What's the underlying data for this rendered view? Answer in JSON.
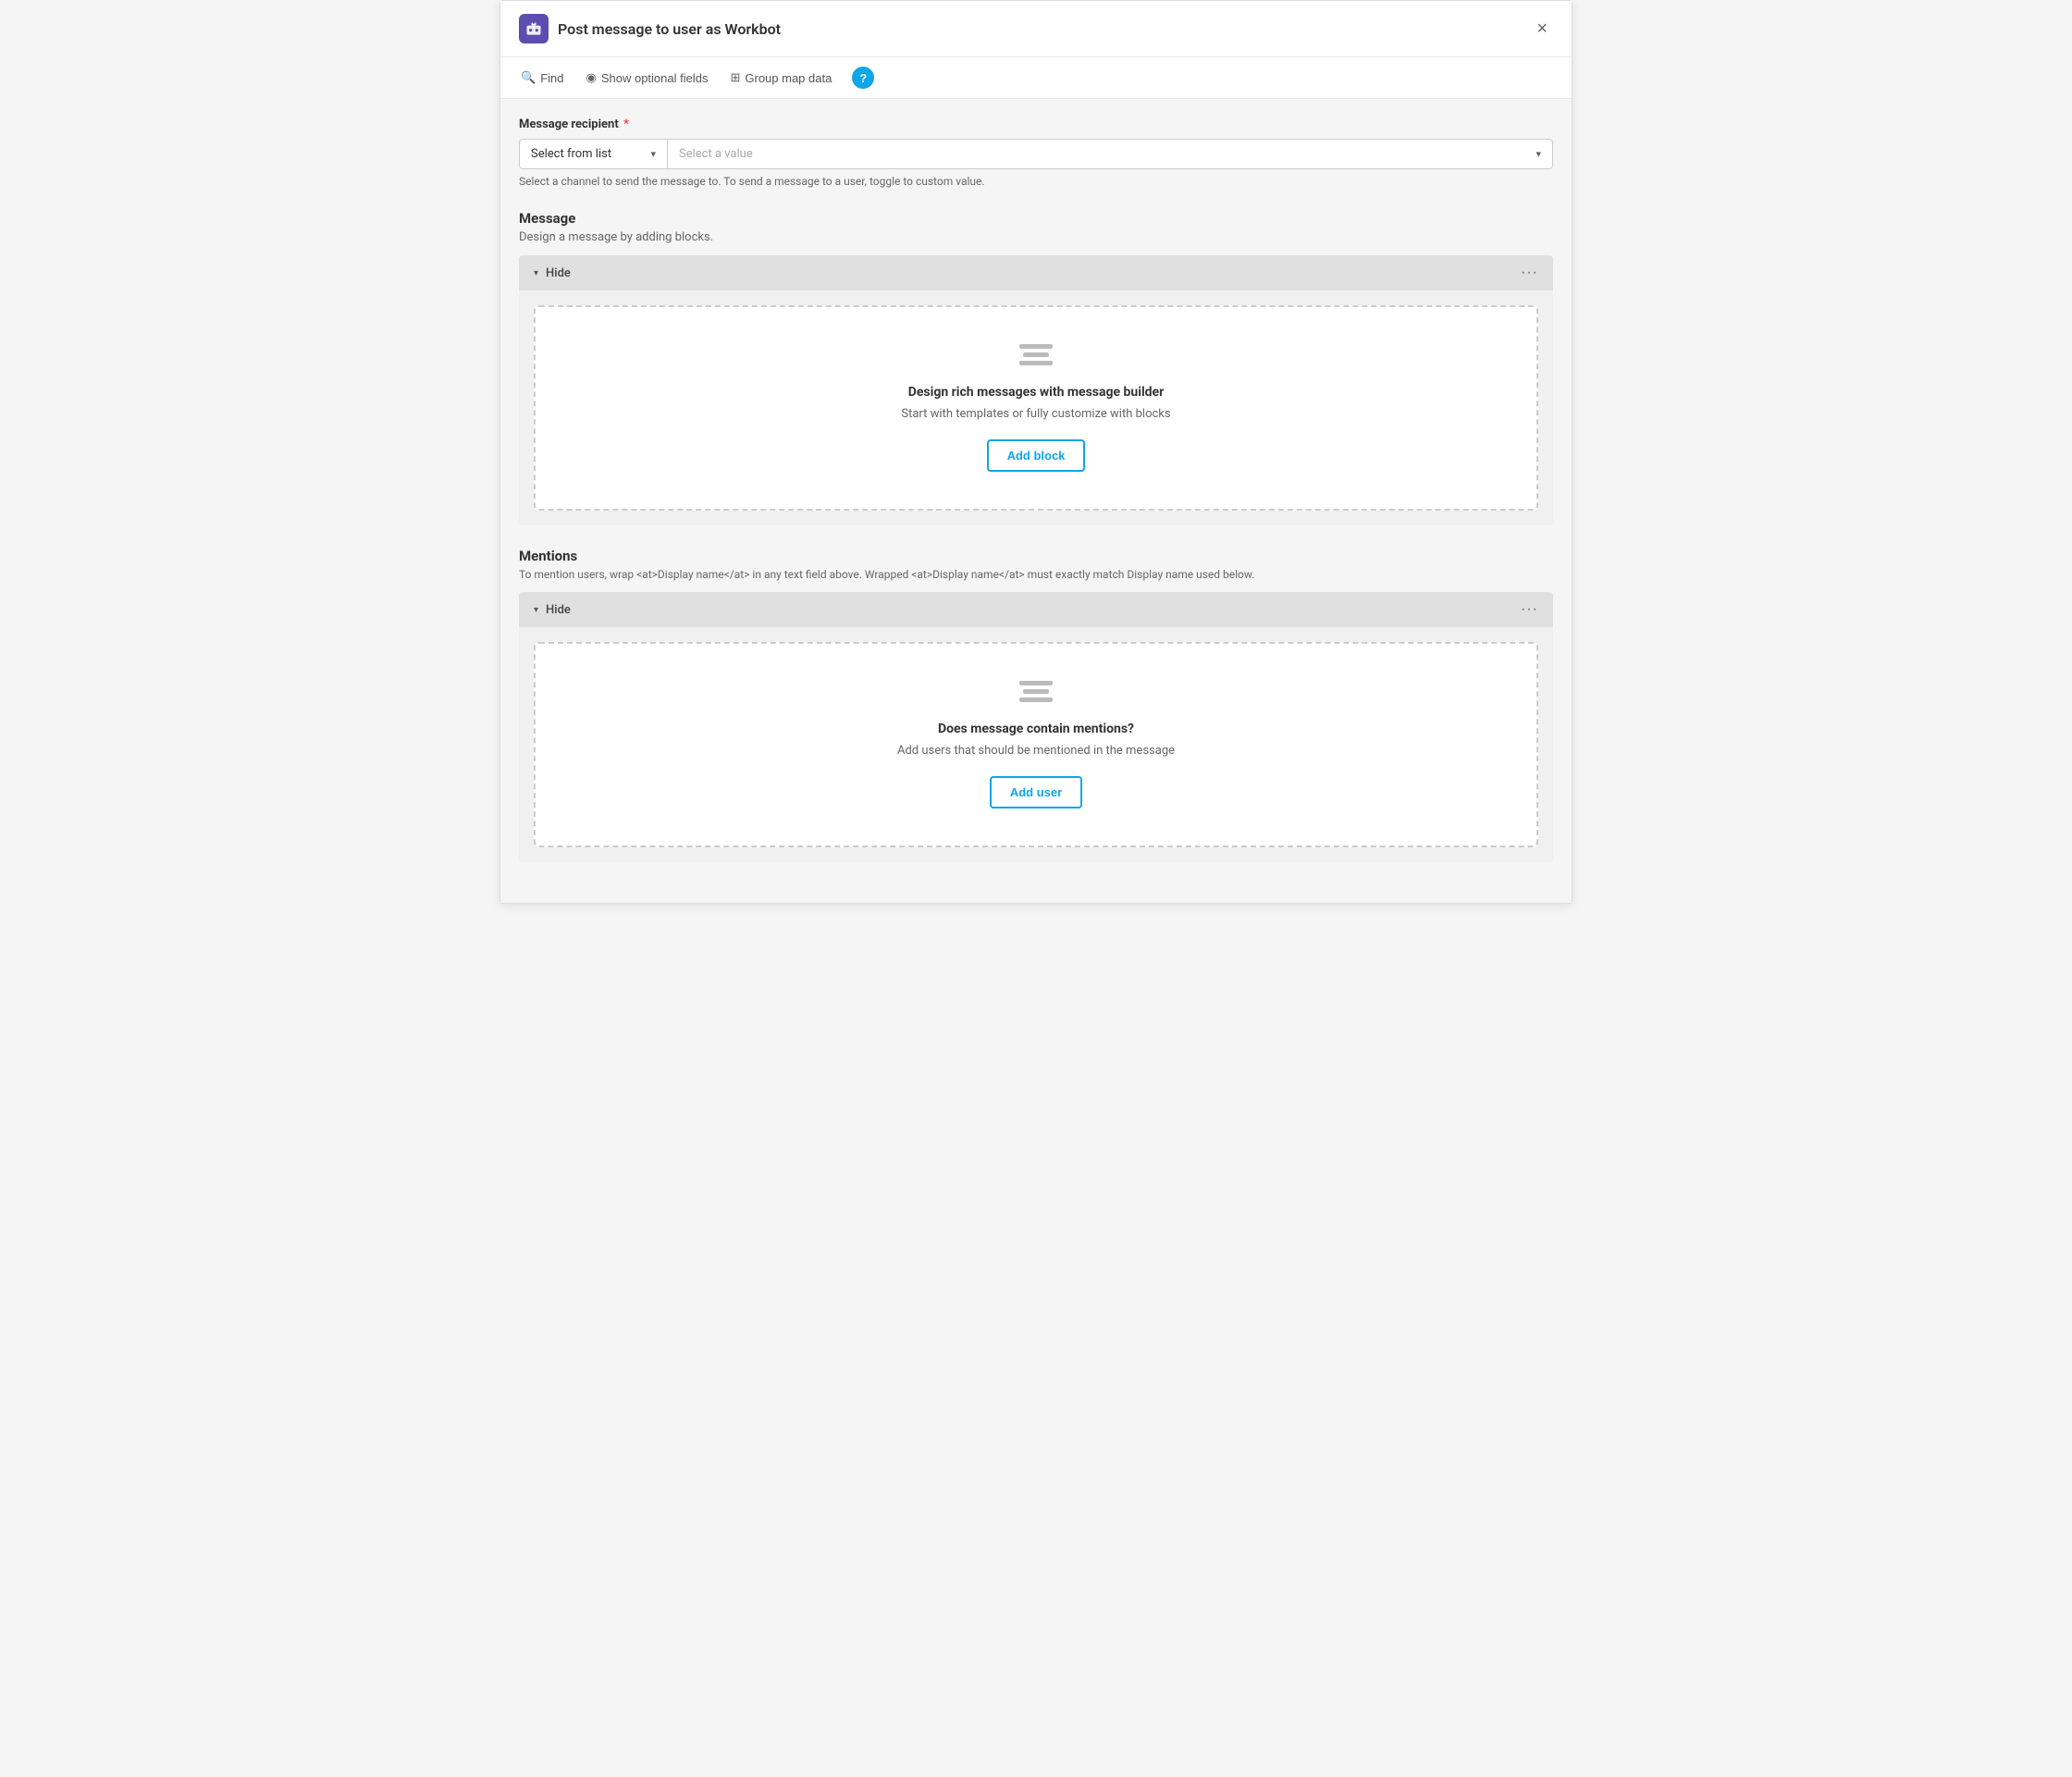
{
  "header": {
    "title": "Post message to user as Workbot",
    "close_label": "×"
  },
  "toolbar": {
    "find_label": "Find",
    "show_optional_label": "Show optional fields",
    "group_map_label": "Group map data",
    "help_label": "?"
  },
  "message_recipient": {
    "label": "Message recipient",
    "required": true,
    "select_type": "Select from list",
    "select_value_placeholder": "Select a value",
    "hint": "Select a channel to send the message to. To send a message to a user, toggle to custom value."
  },
  "message_section": {
    "title": "Message",
    "description": "Design a message by adding blocks.",
    "panel_label": "Hide",
    "panel_menu": "···",
    "dashed_box": {
      "title": "Design rich messages with message builder",
      "description": "Start with templates or fully customize with blocks",
      "button_label": "Add block"
    }
  },
  "mentions_section": {
    "title": "Mentions",
    "hint": "To mention users, wrap <at>Display name</at> in any text field above. Wrapped <at>Display name</at> must exactly match Display name used below.",
    "panel_label": "Hide",
    "panel_menu": "···",
    "dashed_box": {
      "title": "Does message contain mentions?",
      "description": "Add users that should be mentioned in the message",
      "button_label": "Add user"
    }
  },
  "icons": {
    "find": "🔍",
    "eye": "👁",
    "group": "⊞",
    "chevron_down": "▾",
    "collapse": "▾",
    "dots": "···"
  }
}
